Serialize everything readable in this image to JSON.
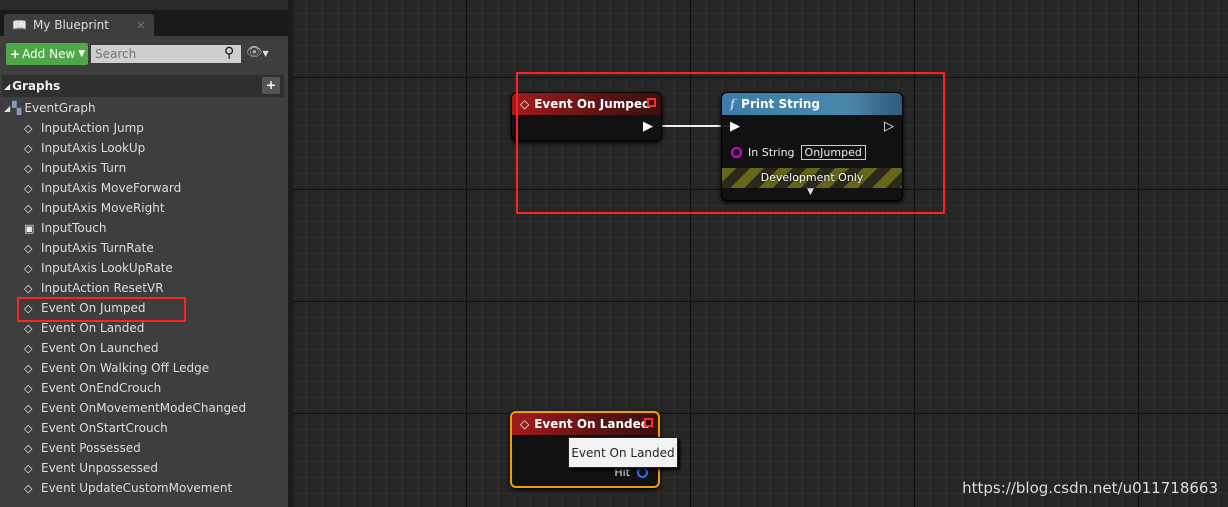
{
  "panel": {
    "tab_title": "My Blueprint",
    "close": "×",
    "add_new": "Add New",
    "search_placeholder": "Search",
    "graphs_header": "Graphs",
    "graphs_add": "+",
    "event_graph": "EventGraph",
    "items": [
      {
        "label": "InputAction Jump",
        "icon": "event-diamond"
      },
      {
        "label": "InputAxis LookUp",
        "icon": "event-diamond"
      },
      {
        "label": "InputAxis Turn",
        "icon": "event-diamond"
      },
      {
        "label": "InputAxis MoveForward",
        "icon": "event-diamond"
      },
      {
        "label": "InputAxis MoveRight",
        "icon": "event-diamond"
      },
      {
        "label": "InputTouch",
        "icon": "touch"
      },
      {
        "label": "InputAxis TurnRate",
        "icon": "event-diamond"
      },
      {
        "label": "InputAxis LookUpRate",
        "icon": "event-diamond"
      },
      {
        "label": "InputAction ResetVR",
        "icon": "event-diamond"
      },
      {
        "label": "Event On Jumped",
        "icon": "event-diamond",
        "highlighted": true
      },
      {
        "label": "Event On Landed",
        "icon": "event-diamond"
      },
      {
        "label": "Event On Launched",
        "icon": "event-diamond"
      },
      {
        "label": "Event On Walking Off Ledge",
        "icon": "event-diamond"
      },
      {
        "label": "Event OnEndCrouch",
        "icon": "event-diamond"
      },
      {
        "label": "Event OnMovementModeChanged",
        "icon": "event-diamond"
      },
      {
        "label": "Event OnStartCrouch",
        "icon": "event-diamond"
      },
      {
        "label": "Event Possessed",
        "icon": "event-diamond"
      },
      {
        "label": "Event Unpossessed",
        "icon": "event-diamond"
      },
      {
        "label": "Event UpdateCustomMovement",
        "icon": "event-diamond"
      }
    ]
  },
  "graph": {
    "node_jumped": {
      "title": "Event On Jumped"
    },
    "node_print": {
      "title": "Print String",
      "in_string_label": "In String",
      "in_string_value": "OnJumped",
      "dev_only": "Development Only"
    },
    "node_landed": {
      "title": "Event On Landed",
      "pin": "Hit"
    },
    "tooltip": "Event On Landed",
    "highlight_color": "#ff2222"
  },
  "watermark": "https://blog.csdn.net/u011718663"
}
